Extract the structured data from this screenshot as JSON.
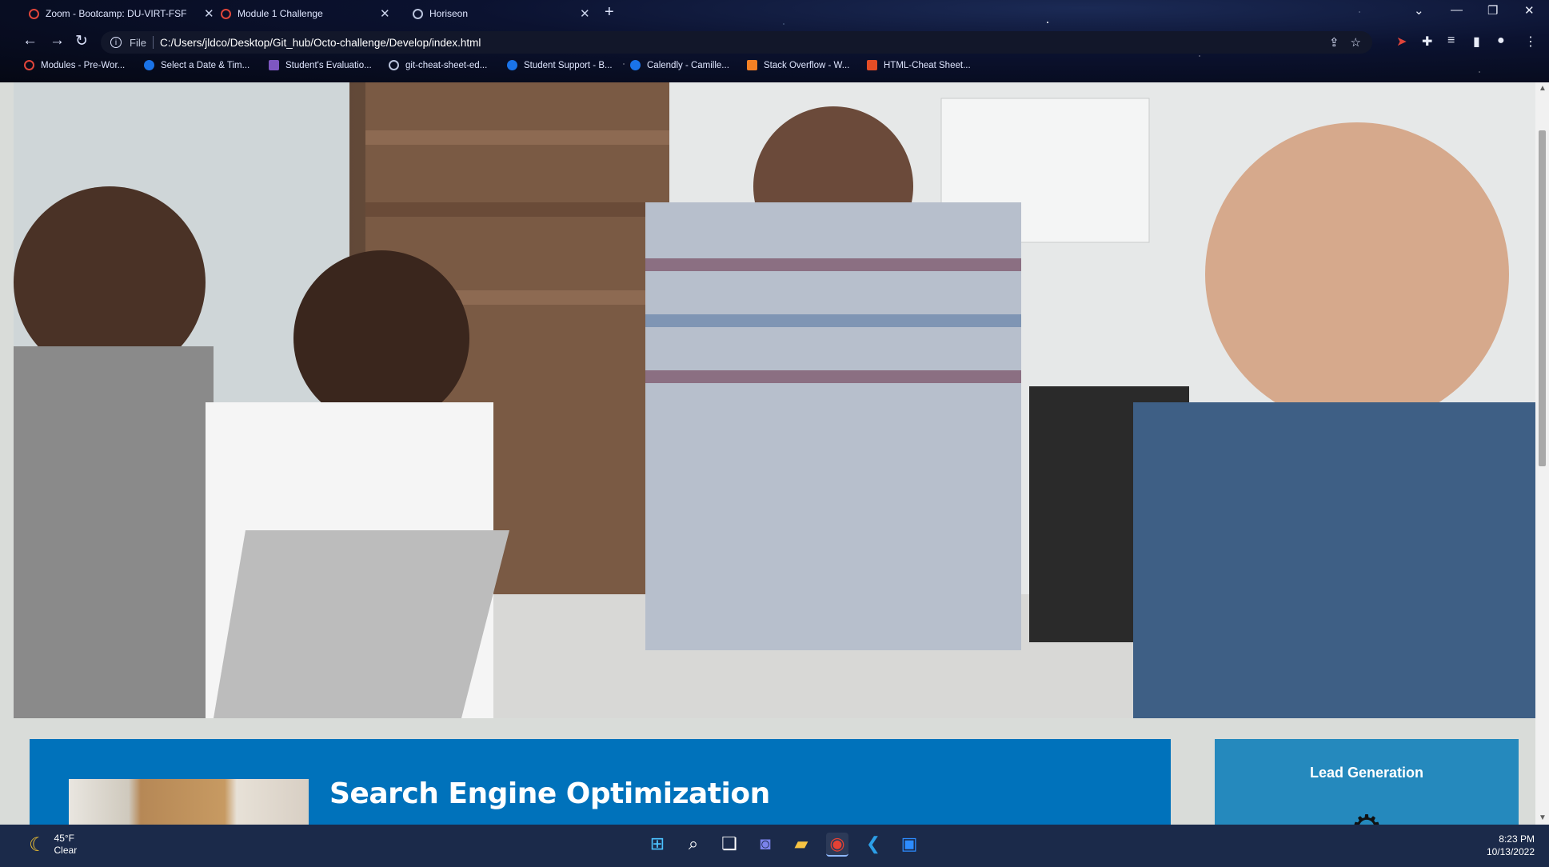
{
  "browser": {
    "tabs": [
      {
        "label": "Zoom - Bootcamp: DU-VIRT-FSF",
        "icon": "zoom-favicon"
      },
      {
        "label": "Module 1 Challenge",
        "icon": "canvas-favicon"
      },
      {
        "label": "Horiseon",
        "icon": "globe-icon"
      }
    ],
    "new_tab": "+",
    "address": {
      "scheme_label": "File",
      "url": "C:/Users/jldco/Desktop/Git_hub/Octo-challenge/Develop/index.html"
    },
    "bookmarks": [
      {
        "label": "Modules - Pre-Wor...",
        "color": "#e0453a"
      },
      {
        "label": "Select a Date & Tim...",
        "color": "#1a73e8"
      },
      {
        "label": "Student's Evaluatio...",
        "color": "#7e57c2"
      },
      {
        "label": "git-cheat-sheet-ed...",
        "color": "#b9c3dc"
      },
      {
        "label": "Student Support - B...",
        "color": "#1a73e8"
      },
      {
        "label": "Calendly - Camille...",
        "color": "#1a73e8"
      },
      {
        "label": "Stack Overflow - W...",
        "color": "#f48024"
      },
      {
        "label": "HTML-Cheat Sheet...",
        "color": "#e44d26"
      }
    ]
  },
  "page": {
    "hero_alt": "",
    "main_card": {
      "title": "Search Engine Optimization",
      "bg": "#0072bb"
    },
    "aside_card": {
      "title": "Lead Generation",
      "bg": "#2589bd",
      "icon": "gear-icon"
    }
  },
  "taskbar": {
    "weather": {
      "temp": "45°F",
      "condition": "Clear"
    },
    "apps": [
      "windows-start-icon",
      "search-icon",
      "task-view-icon",
      "teams-chat-icon",
      "file-explorer-icon",
      "chrome-icon",
      "vscode-icon",
      "zoom-icon"
    ],
    "clock": {
      "time": "8:23 PM",
      "date": "10/13/2022"
    }
  }
}
